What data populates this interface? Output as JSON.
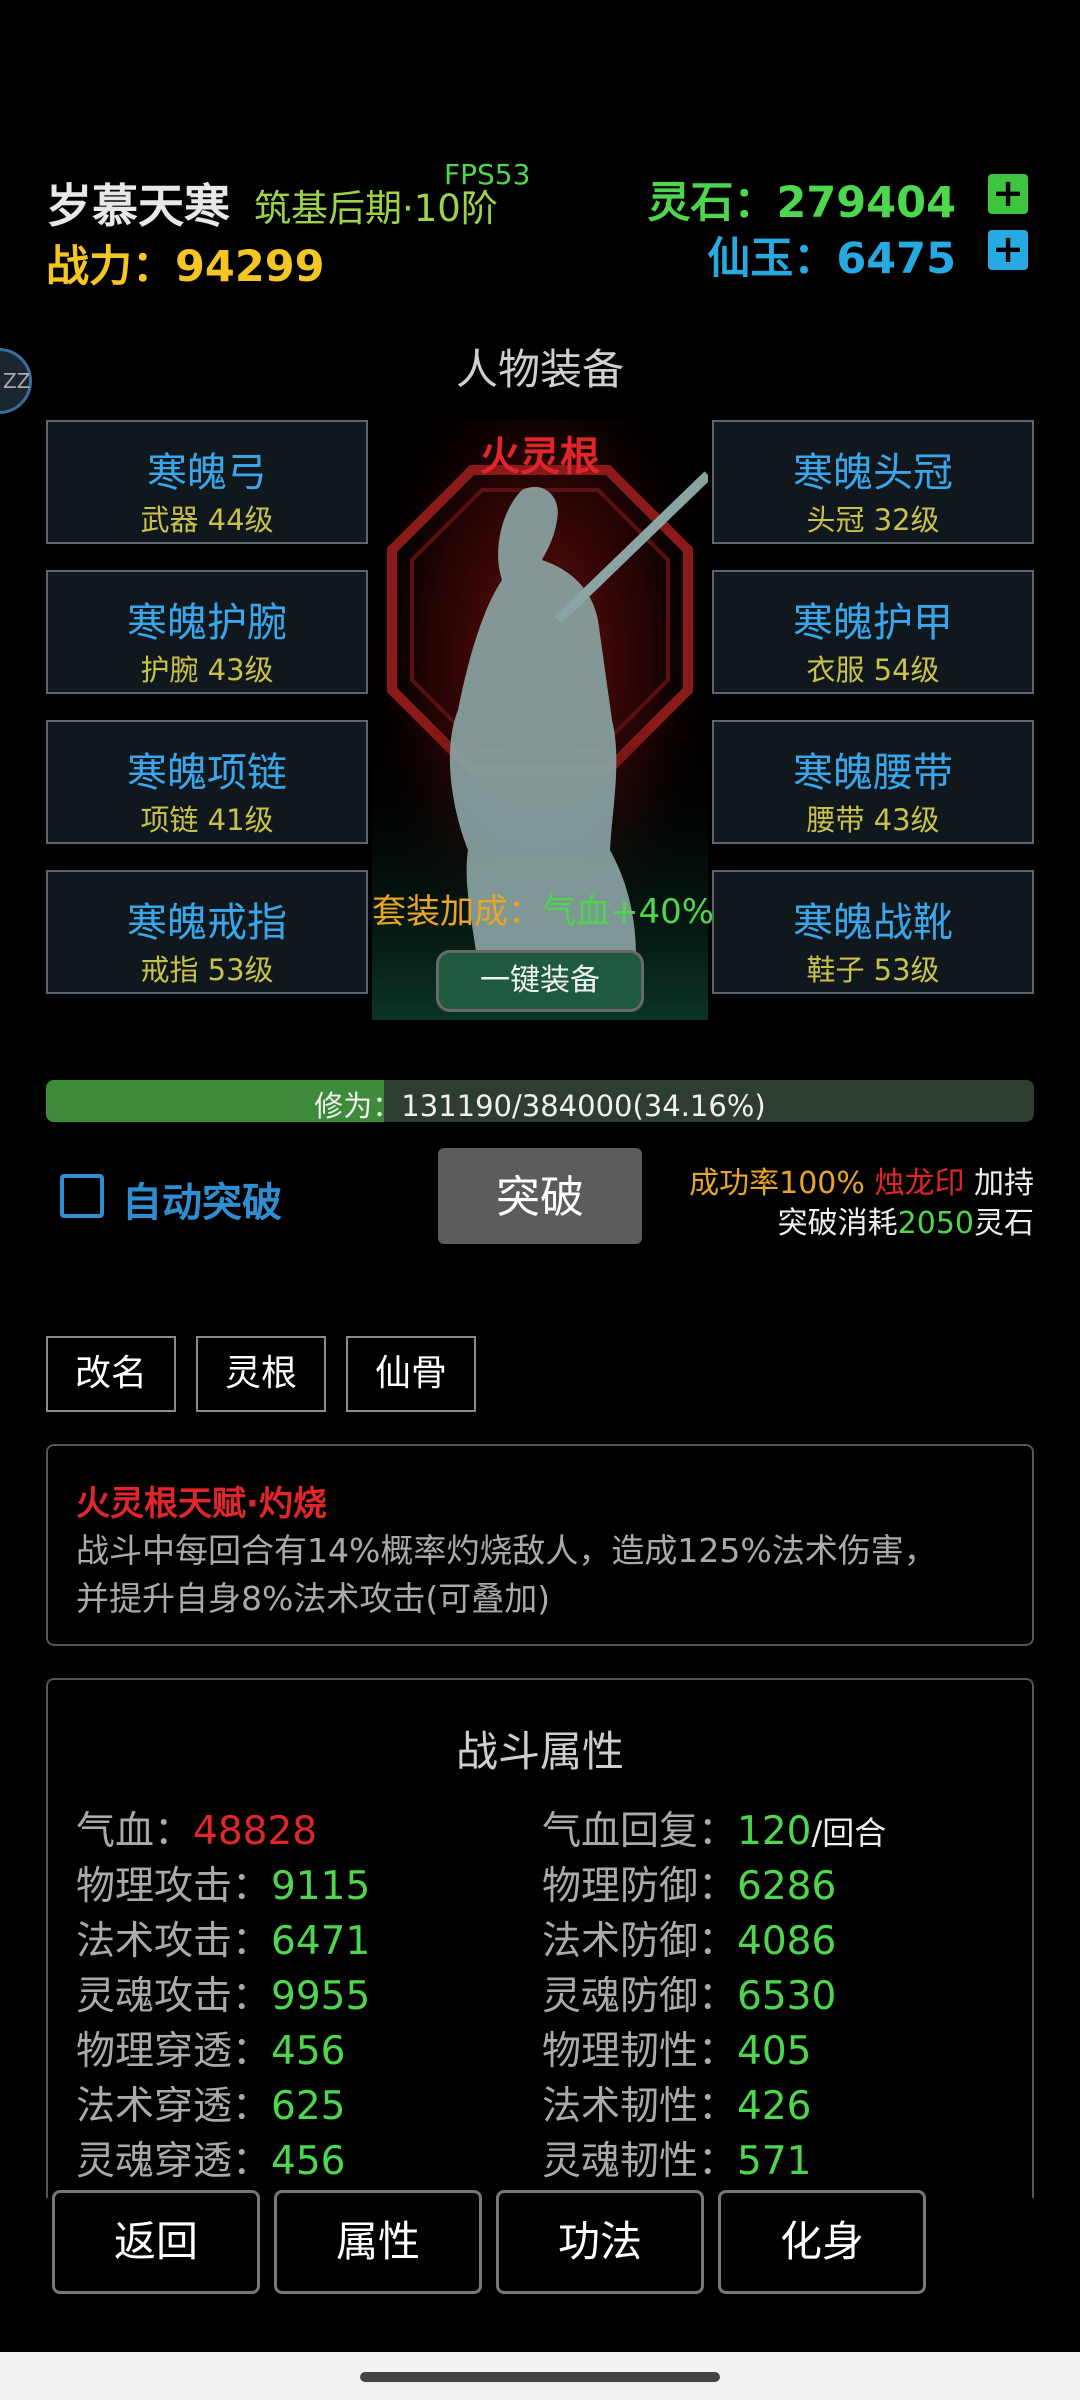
{
  "header": {
    "player_name": "岁慕天寒",
    "realm": "筑基后期·10阶",
    "fps": "FPS53",
    "power_label": "战力：",
    "power_value": "94299",
    "spirit_stone_label": "灵石：",
    "spirit_stone_value": "279404",
    "jade_label": "仙玉：",
    "jade_value": "6475",
    "add_symbol": "+"
  },
  "side_bubble": {
    "text": "ZZ"
  },
  "equipment": {
    "title": "人物装备",
    "root_label": "火灵根",
    "set_bonus_label": "套装加成：",
    "set_bonus_value": "气血+40%",
    "one_click_label": "一键装备",
    "left": [
      {
        "name": "寒魄弓",
        "level": "武器 44级"
      },
      {
        "name": "寒魄护腕",
        "level": "护腕 43级"
      },
      {
        "name": "寒魄项链",
        "level": "项链 41级"
      },
      {
        "name": "寒魄戒指",
        "level": "戒指 53级"
      }
    ],
    "right": [
      {
        "name": "寒魄头冠",
        "level": "头冠 32级"
      },
      {
        "name": "寒魄护甲",
        "level": "衣服 54级"
      },
      {
        "name": "寒魄腰带",
        "level": "腰带 43级"
      },
      {
        "name": "寒魄战靴",
        "level": "鞋子 53级"
      }
    ]
  },
  "cultivation": {
    "text": "修为：131190/384000(34.16%)",
    "fraction": 0.3416
  },
  "breakthrough": {
    "auto_label": "自动突破",
    "button_label": "突破",
    "success_rate": "成功率100%",
    "seal": "烛龙印",
    "bonus": "加持",
    "cost_prefix": "突破消耗",
    "cost_value": "2050",
    "cost_suffix": "灵石"
  },
  "actions": [
    "改名",
    "灵根",
    "仙骨"
  ],
  "talent": {
    "title": "火灵根天赋·灼烧",
    "desc1": "战斗中每回合有14%概率灼烧敌人，造成125%法术伤害，",
    "desc2": "并提升自身8%法术攻击(可叠加)"
  },
  "stats": {
    "title": "战斗属性",
    "left": [
      {
        "label": "气血：",
        "value": "48828"
      },
      {
        "label": "物理攻击：",
        "value": "9115"
      },
      {
        "label": "法术攻击：",
        "value": "6471"
      },
      {
        "label": "灵魂攻击：",
        "value": "9955"
      },
      {
        "label": "物理穿透：",
        "value": "456"
      },
      {
        "label": "法术穿透：",
        "value": "625"
      },
      {
        "label": "灵魂穿透：",
        "value": "456"
      }
    ],
    "right": [
      {
        "label": "气血回复：",
        "value": "120",
        "unit": "/回合"
      },
      {
        "label": "物理防御：",
        "value": "6286"
      },
      {
        "label": "法术防御：",
        "value": "4086"
      },
      {
        "label": "灵魂防御：",
        "value": "6530"
      },
      {
        "label": "物理韧性：",
        "value": "405"
      },
      {
        "label": "法术韧性：",
        "value": "426"
      },
      {
        "label": "灵魂韧性：",
        "value": "571"
      }
    ]
  },
  "bottom_nav": [
    "返回",
    "属性",
    "功法",
    "化身"
  ],
  "colors": {
    "spirit_stone": "#4ed64e",
    "jade": "#27a9e1",
    "power": "#f3c623",
    "equip_name": "#3aa6e9",
    "equip_level": "#c8c14a",
    "red": "#e0262a"
  }
}
